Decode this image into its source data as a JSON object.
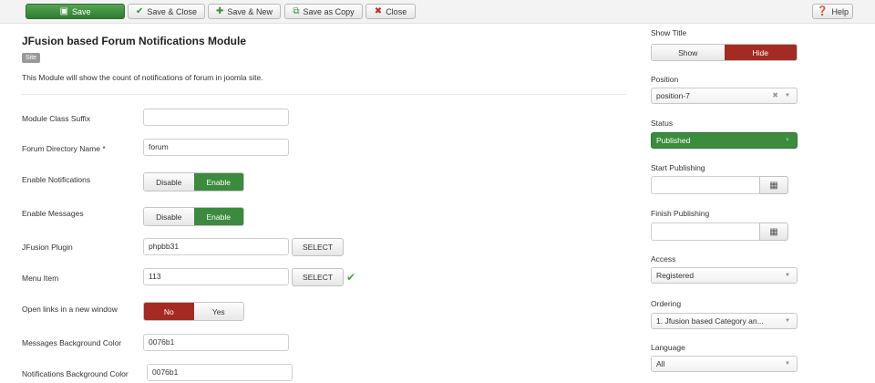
{
  "toolbar": {
    "save": "Save",
    "save_close": "Save & Close",
    "save_new": "Save & New",
    "save_copy": "Save as Copy",
    "close": "Close",
    "help": "Help"
  },
  "module": {
    "title": "JFusion based Forum Notifications Module",
    "badge": "Site",
    "description": "This Module will show the count of notifications of forum in joomla site."
  },
  "fields": {
    "class_suffix": {
      "label": "Module Class Suffix",
      "value": ""
    },
    "forum_dir": {
      "label": "Forum Directory Name *",
      "value": "forum"
    },
    "notifications": {
      "label": "Enable Notifications",
      "off": "Disable",
      "on": "Enable",
      "selected": "Enable"
    },
    "messages": {
      "label": "Enable Messages",
      "off": "Disable",
      "on": "Enable",
      "selected": "Enable"
    },
    "plugin": {
      "label": "JFusion Plugin",
      "value": "phpbb31",
      "button": "SELECT"
    },
    "menu_item": {
      "label": "Menu Item",
      "value": "113",
      "button": "SELECT"
    },
    "new_window": {
      "label": "Open links in a new window",
      "no": "No",
      "yes": "Yes",
      "selected": "No"
    },
    "msg_bg": {
      "label": "Messages Background Color",
      "value": "0076b1"
    },
    "notif_bg": {
      "label": "Notifications Background Color",
      "value": "0076b1"
    }
  },
  "sidebar": {
    "show_title": {
      "label": "Show Title",
      "show": "Show",
      "hide": "Hide",
      "selected": "Hide"
    },
    "position": {
      "label": "Position",
      "value": "position-7"
    },
    "status": {
      "label": "Status",
      "value": "Published"
    },
    "start_publishing": {
      "label": "Start Publishing",
      "value": ""
    },
    "finish_publishing": {
      "label": "Finish Publishing",
      "value": ""
    },
    "access": {
      "label": "Access",
      "value": "Registered"
    },
    "ordering": {
      "label": "Ordering",
      "value": "1. Jfusion based Category an..."
    },
    "language": {
      "label": "Language",
      "value": "All"
    }
  },
  "colors": {
    "save_green": "#2f7d32",
    "toggle_green": "#3b8a3e",
    "toggle_red": "#a52a23",
    "status_green": "#3c8c3e"
  },
  "icons": {
    "save": "save-icon",
    "check": "check-icon",
    "plus": "plus-icon",
    "copy": "copy-icon",
    "close": "close-circle-icon",
    "help": "help-icon",
    "calendar": "calendar-icon"
  }
}
